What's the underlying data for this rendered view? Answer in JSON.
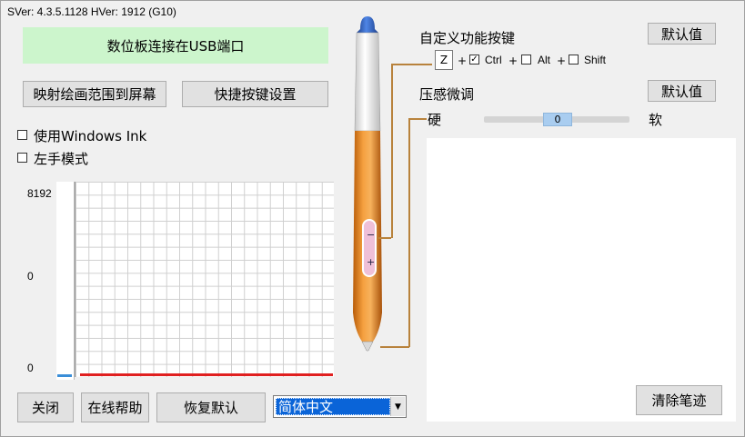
{
  "header": {
    "version_text": "SVer: 4.3.5.1128  HVer: 1912  (G10)"
  },
  "status": {
    "connection_text": "数位板连接在USB端口",
    "color": "#ccf5cc"
  },
  "left_buttons": {
    "map_area_label": "映射绘画范围到屏幕",
    "shortcut_settings_label": "快捷按键设置"
  },
  "options": {
    "windows_ink": {
      "label": "使用Windows Ink",
      "checked": false
    },
    "left_hand": {
      "label": "左手模式",
      "checked": false
    }
  },
  "graph": {
    "y_labels": [
      "8192",
      "0",
      "0"
    ],
    "curve_color": "#e02020",
    "pressure_color": "#3a8ed8"
  },
  "bottom_buttons": {
    "close_label": "关闭",
    "help_label": "在线帮助",
    "restore_label": "恢复默认"
  },
  "language_select": {
    "selected": "简体中文",
    "arrow": "▼"
  },
  "custom_keys": {
    "title": "自定义功能按键",
    "default_label": "默认值",
    "key_value": "Z",
    "plus": "+",
    "ctrl": {
      "label": "Ctrl",
      "checked": true
    },
    "alt": {
      "label": "Alt",
      "checked": false
    },
    "shift": {
      "label": "Shift",
      "checked": false
    }
  },
  "pressure": {
    "title": "压感微调",
    "default_label": "默认值",
    "hard_label": "硬",
    "soft_label": "软",
    "slider_value": "0"
  },
  "draw_area": {
    "clear_label": "清除笔迹"
  },
  "pen": {
    "minus": "−",
    "plus": "+",
    "body_color": "#e8891a",
    "cap_color": "#2b63c8"
  }
}
